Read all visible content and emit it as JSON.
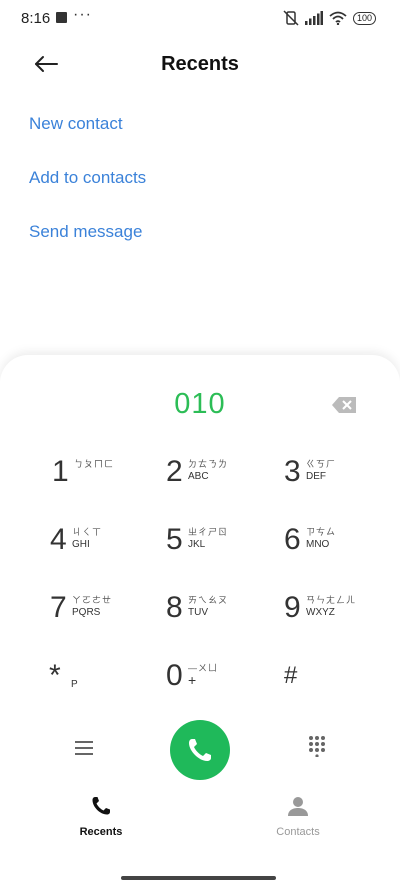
{
  "status_bar": {
    "time": "8:16",
    "overflow_dots": "···",
    "battery": "100",
    "icons": [
      "square-notification-icon",
      "mute-vibrate-icon",
      "signal-icon",
      "wifi-icon",
      "battery-icon"
    ]
  },
  "header": {
    "title": "Recents",
    "back_icon": "back-arrow-icon"
  },
  "actions": [
    "New contact",
    "Add to contacts",
    "Send message"
  ],
  "dialer": {
    "number": "010",
    "keys": [
      {
        "digit": "1",
        "top": "ㄅㄆㄇㄈ",
        "bottom": ""
      },
      {
        "digit": "2",
        "top": "ㄉㄊㄋㄌ",
        "bottom": "ABC"
      },
      {
        "digit": "3",
        "top": "ㄍㄎㄏ",
        "bottom": "DEF"
      },
      {
        "digit": "4",
        "top": "ㄐㄑㄒ",
        "bottom": "GHI"
      },
      {
        "digit": "5",
        "top": "ㄓㄔㄕㄖ",
        "bottom": "JKL"
      },
      {
        "digit": "6",
        "top": "ㄗㄘㄙ",
        "bottom": "MNO"
      },
      {
        "digit": "7",
        "top": "ㄚㄛㄜㄝ",
        "bottom": "PQRS"
      },
      {
        "digit": "8",
        "top": "ㄞㄟㄠㄡ",
        "bottom": "TUV"
      },
      {
        "digit": "9",
        "top": "ㄢㄣㄤㄥㄦ",
        "bottom": "WXYZ"
      },
      {
        "digit": "*",
        "top": "",
        "bottom": "P"
      },
      {
        "digit": "0",
        "top": "—ㄨㄩ",
        "bottom": "+"
      },
      {
        "digit": "#",
        "top": "",
        "bottom": ""
      }
    ],
    "colors": {
      "number": "#2cbd56",
      "call_button": "#1fb95a"
    }
  },
  "bottom_nav": {
    "tabs": [
      {
        "label": "Recents",
        "icon": "phone-icon",
        "active": true
      },
      {
        "label": "Contacts",
        "icon": "person-icon",
        "active": false
      }
    ]
  }
}
